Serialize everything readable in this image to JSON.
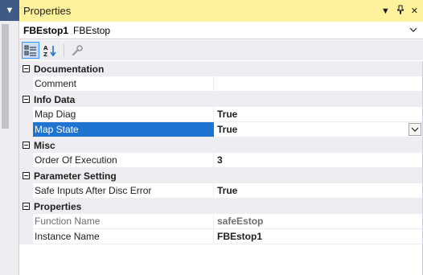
{
  "panel": {
    "title": "Properties"
  },
  "selector": {
    "object_name": "FBEstop1",
    "object_type": "FBEstop"
  },
  "toolbar": {
    "tools": [
      "categorized-icon",
      "alphabetical-icon",
      "property-pages-icon"
    ]
  },
  "grid": {
    "categories": [
      {
        "label": "Documentation",
        "properties": [
          {
            "name": "Comment",
            "value": ""
          }
        ]
      },
      {
        "label": "Info Data",
        "properties": [
          {
            "name": "Map Diag",
            "value": "True"
          },
          {
            "name": "Map State",
            "value": "True"
          }
        ]
      },
      {
        "label": "Misc",
        "properties": [
          {
            "name": "Order Of Execution",
            "value": "3"
          }
        ]
      },
      {
        "label": "Parameter Setting",
        "properties": [
          {
            "name": "Safe Inputs After Disc Error",
            "value": "True"
          }
        ]
      },
      {
        "label": "Properties",
        "properties": [
          {
            "name": "Function Name",
            "value": "safeEstop"
          },
          {
            "name": "Instance Name",
            "value": "FBEstop1"
          }
        ]
      }
    ]
  },
  "colors": {
    "title_bar": "#fff29d",
    "selection": "#1f74d1",
    "category_bg": "#eeeef2"
  }
}
